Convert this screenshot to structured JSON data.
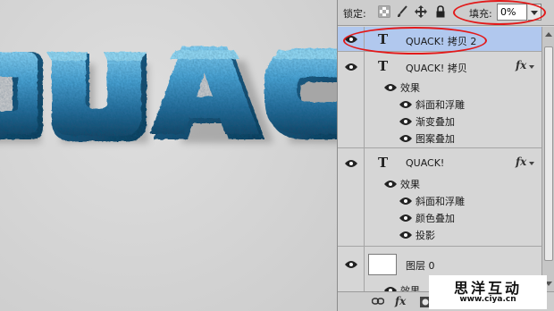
{
  "canvas": {
    "text": "QUACK!"
  },
  "toolbar": {
    "lock_label": "锁定:",
    "lock_icons": [
      "lock-transparent-icon",
      "lock-brush-icon",
      "lock-move-icon",
      "lock-all-icon"
    ],
    "fill_label": "填充:",
    "fill_value": "0%"
  },
  "layers": [
    {
      "name": "QUACK! 拷贝 2",
      "type": "text",
      "selected": true,
      "visible": true,
      "has_fx": false,
      "effects_label": "",
      "effects": []
    },
    {
      "name": "QUACK! 拷贝",
      "type": "text",
      "selected": false,
      "visible": true,
      "has_fx": true,
      "effects_label": "效果",
      "effects": [
        "斜面和浮雕",
        "渐变叠加",
        "图案叠加"
      ]
    },
    {
      "name": "QUACK!",
      "type": "text",
      "selected": false,
      "visible": true,
      "has_fx": true,
      "effects_label": "效果",
      "effects": [
        "斜面和浮雕",
        "颜色叠加",
        "投影"
      ]
    },
    {
      "name": "图层 0",
      "type": "raster",
      "selected": false,
      "visible": true,
      "has_fx": false,
      "effects_label": "效果",
      "effects": []
    }
  ],
  "bottom_bar": {
    "icons": [
      "link-icon",
      "fx-icon",
      "mask-icon"
    ],
    "fx_label": "fx"
  },
  "watermark": {
    "title": "思洋互动",
    "url": "www.ciya.cn"
  },
  "colors": {
    "selection": "#b1c8ee",
    "annotation": "#e21a1a",
    "stone_light": "#6ec6ef",
    "stone_dark": "#1d4f78"
  }
}
